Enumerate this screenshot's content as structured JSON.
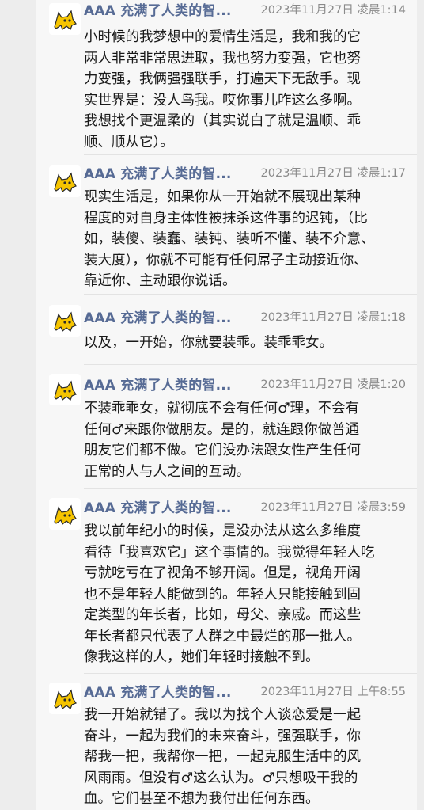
{
  "messages": [
    {
      "sender": "AAA 充满了人类的智...",
      "time": "2023年11月27日 凌晨1:14",
      "lines": "小时候的我梦想中的爱情生活是，我和我的它\n两人非常非常思进取，我也努力变强，它也努\n力变强，我俩强强联手，打遍天下无敌手。现\n实世界是：没人鸟我。哎你事儿咋这么多啊。\n我想找个更温柔的（其实说白了就是温顺、乖\n顺、顺从它）。"
    },
    {
      "sender": "AAA 充满了人类的智...",
      "time": "2023年11月27日 凌晨1:17",
      "lines": "现实生活是，如果你从一开始就不展现出某种\n程度的对自身主体性被抹杀这件事的迟钝，（比\n如，装傻、装蠢、装钝、装听不懂、装不介意、\n装大度），你就不可能有任何屌子主动接近你、\n靠近你、主动跟你说话。"
    },
    {
      "sender": "AAA 充满了人类的智...",
      "time": "2023年11月27日 凌晨1:18",
      "lines": "以及，一开始，你就要装乖。装乖乖女。"
    },
    {
      "sender": "AAA 充满了人类的智...",
      "time": "2023年11月27日 凌晨1:20",
      "lines": "不装乖乖女，就彻底不会有任何♂理，不会有\n任何♂来跟你做朋友。是的，就连跟你做普通\n朋友它们都不做。它们没办法跟女性产生任何\n正常的人与人之间的互动。"
    },
    {
      "sender": "AAA 充满了人类的智...",
      "time": "2023年11月27日 凌晨3:59",
      "lines": "我以前年纪小的时候，是没办法从这么多维度\n看待「我喜欢它」这个事情的。我觉得年轻人吃\n亏就吃亏在了视角不够开阔。但是，视角开阔\n也不是年轻人能做到的。年轻人只能接触到固\n定类型的年长者，比如，母父、亲戚。而这些\n年长者都只代表了人群之中最烂的那一批人。\n像我这样的人，她们年轻时接触不到。"
    },
    {
      "sender": "AAA 充满了人类的智...",
      "time": "2023年11月27日 上午8:55",
      "lines": "我一开始就错了。我以为找个人谈恋爱是一起\n奋斗，一起为我们的未来奋斗，强强联手，你\n帮我一把，我帮你一把，一起克服生活中的风\n风雨雨。但没有♂这么认为。♂只想吸干我的\n血。它们甚至不想为我付出任何东西。"
    }
  ]
}
